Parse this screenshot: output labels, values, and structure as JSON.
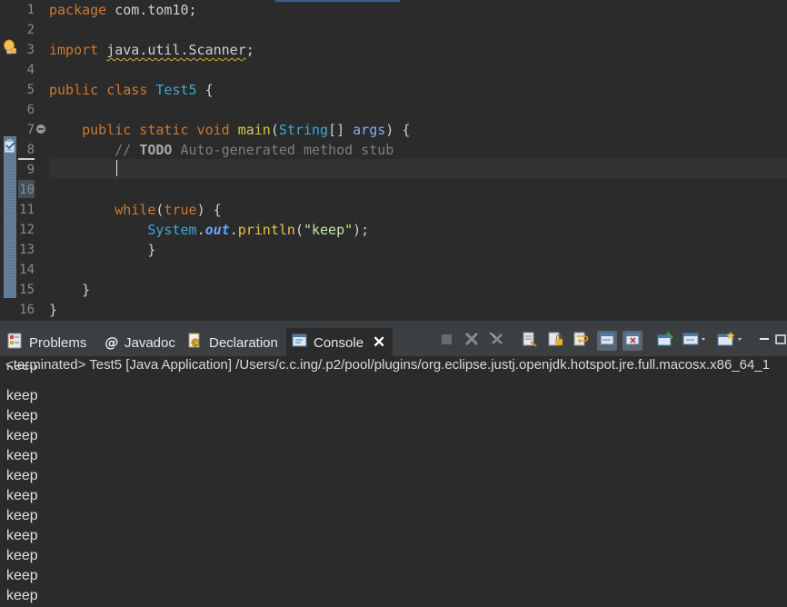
{
  "editor": {
    "line_numbers": [
      "1",
      "2",
      "3",
      "4",
      "5",
      "6",
      "7",
      "8",
      "9",
      "10",
      "11",
      "12",
      "13",
      "14",
      "15",
      "16"
    ],
    "lines": {
      "l1_kw": "package",
      "l1_rest": " com.tom10;",
      "l3_kw": "import",
      "l3_path": "java.util.Scanner",
      "l3_semi": ";",
      "l5_kw": "public class",
      "l5_cls": "Test5",
      "l5_rest": " {",
      "l7_kw": "public static void",
      "l7_mth": "main",
      "l7_p1": "(",
      "l7_type": "String",
      "l7_p2": "[] ",
      "l7_param": "args",
      "l7_rest": ") {",
      "l8_cmt": "// ",
      "l8_todo": "TODO",
      "l8_rest": " Auto-generated method stub",
      "l11_kw": "while",
      "l11_p": "(",
      "l11_true": "true",
      "l11_rest": ") {",
      "l12_cls": "System",
      "l12_dot1": ".",
      "l12_field": "out",
      "l12_dot2": ".",
      "l12_mth": "println",
      "l12_p1": "(",
      "l12_str": "\"keep\"",
      "l12_rest": ");",
      "l13": "}",
      "l15": "}",
      "l16": "}"
    },
    "icons": {
      "warning": "warning-bulb-icon",
      "task": "task-marker-icon",
      "fold": "fold-collapse-icon"
    }
  },
  "tabs": [
    {
      "label": "Problems",
      "icon": "problems-icon"
    },
    {
      "label": "Javadoc",
      "icon": "javadoc-icon"
    },
    {
      "label": "Declaration",
      "icon": "declaration-icon"
    },
    {
      "label": "Console",
      "icon": "console-icon",
      "active": true
    }
  ],
  "toolbar": {
    "buttons": [
      "terminate-icon",
      "remove-launch-icon",
      "remove-all-terminated-icon",
      "clear-console-icon",
      "scroll-lock-icon",
      "word-wrap-icon",
      "show-on-stdout-icon",
      "show-on-stderr-icon",
      "pin-console-icon",
      "display-selected-console-icon",
      "open-console-icon",
      "minimize-icon"
    ]
  },
  "console": {
    "header": "<terminated> Test5 [Java Application] /Users/c.c.ing/.p2/pool/plugins/org.eclipse.justj.openjdk.hotspot.jre.full.macosx.x86_64_1",
    "partial_line": "keep",
    "output": [
      "keep",
      "keep",
      "keep",
      "keep",
      "keep",
      "keep",
      "keep",
      "keep",
      "keep",
      "keep",
      "keep",
      "keep"
    ]
  },
  "colors": {
    "editor_bg": "#2b2b2b",
    "keyword": "#cc7832",
    "class_name": "#3fa7d6",
    "method": "#e0c255",
    "string": "#c6e6a8",
    "comment": "#7f7f7f",
    "tab_bar": "#3c3f41"
  }
}
